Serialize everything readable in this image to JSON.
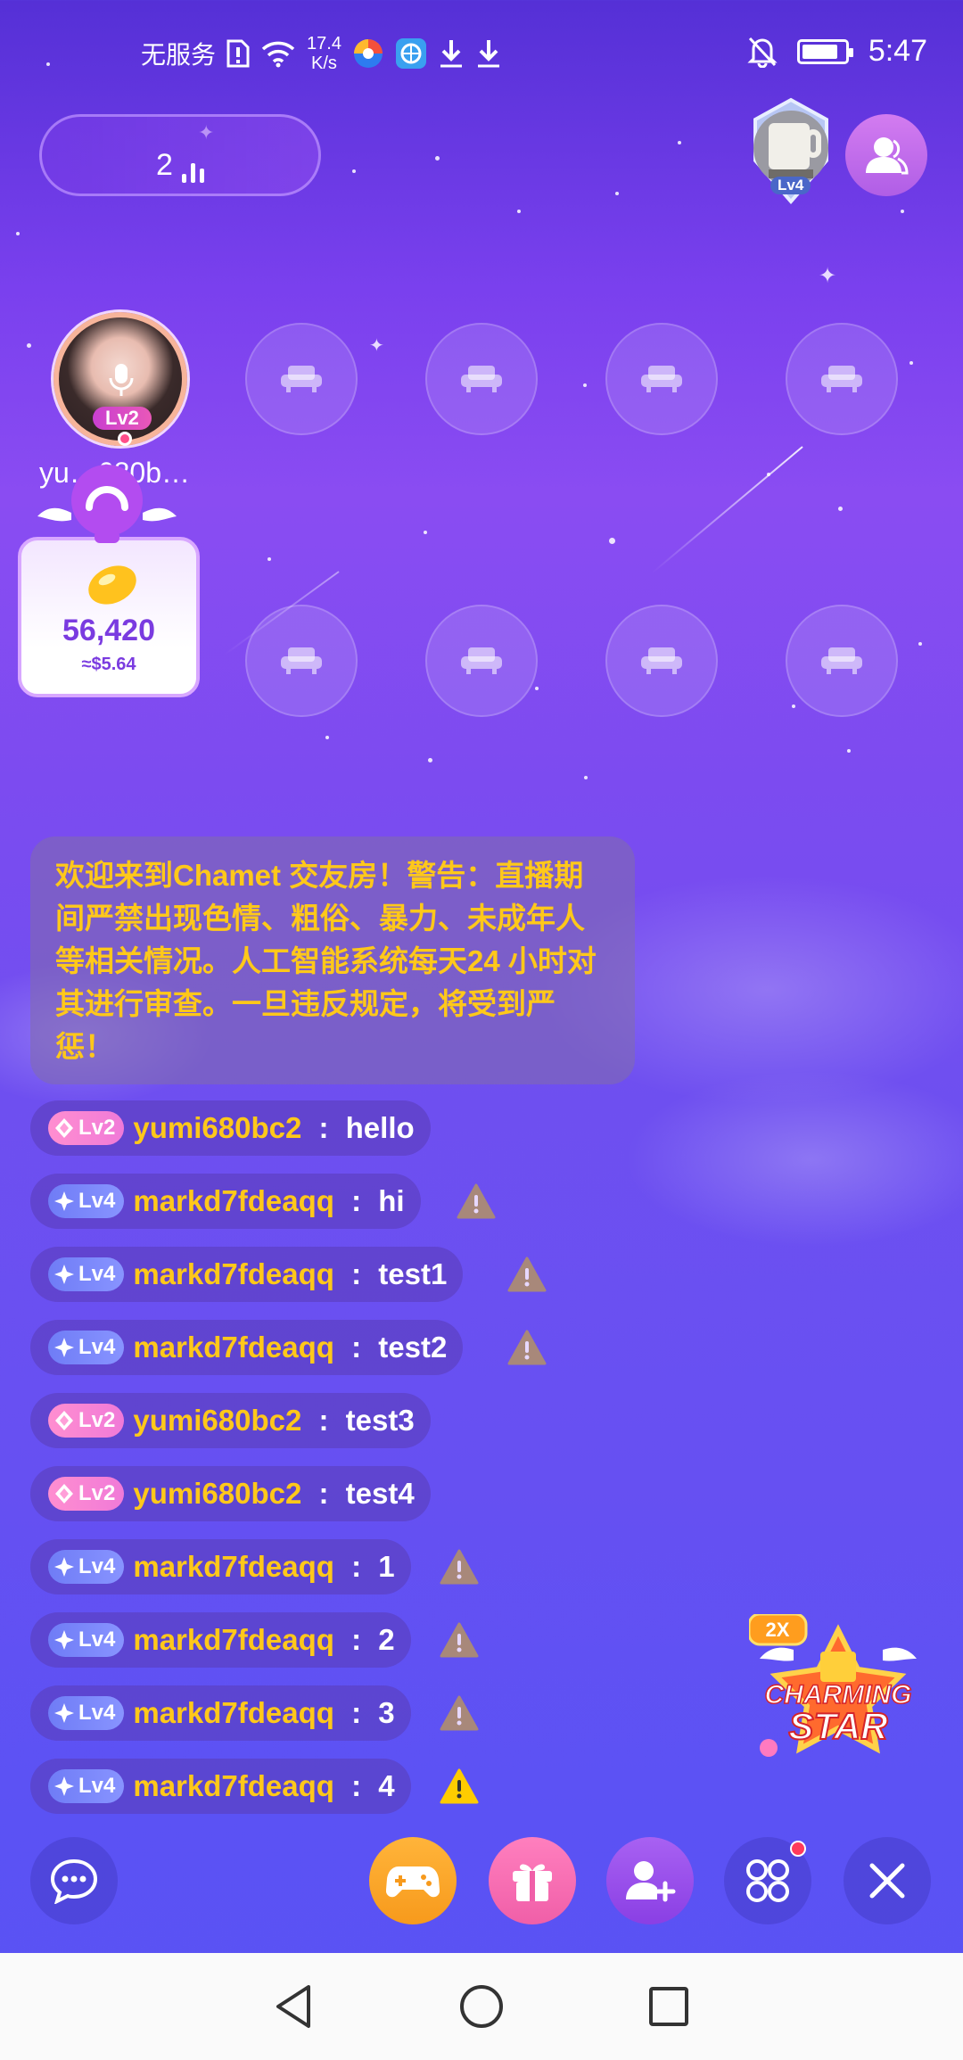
{
  "status_bar": {
    "carrier": "无服务",
    "net_speed_value": "17.4",
    "net_speed_unit": "K/s",
    "time": "5:47",
    "battery_level": 0.85,
    "icons": [
      "sim-alert-icon",
      "wifi-icon",
      "app-browser-icon",
      "app-vpn-icon",
      "download-icon",
      "download-icon",
      "mute-bell-icon",
      "battery-icon"
    ]
  },
  "header": {
    "online_count": "2",
    "host_level": "Lv4"
  },
  "host_seat": {
    "level": "Lv2",
    "name": "yumi680bc2",
    "name_display": "yu…680b…"
  },
  "gift_card": {
    "value": "56,420",
    "usd": "≈$5.64"
  },
  "seat_count_visible": 8,
  "notice": {
    "text": "欢迎来到Chamet 交友房！警告：直播期间严禁出现色情、粗俗、暴力、未成年人等相关情况。人工智能系统每天24 小时对其进行审查。一旦违反规定，将受到严惩！"
  },
  "chat": [
    {
      "level": "Lv2",
      "kind": "lv2",
      "user": "yumi680bc2",
      "message": "hello",
      "warn": false
    },
    {
      "level": "Lv4",
      "kind": "lv4",
      "user": "markd7fdeaqq",
      "message": "hi",
      "warn": true,
      "warn_active": false
    },
    {
      "level": "Lv4",
      "kind": "lv4",
      "user": "markd7fdeaqq",
      "message": "test1",
      "warn": true,
      "warn_active": false
    },
    {
      "level": "Lv4",
      "kind": "lv4",
      "user": "markd7fdeaqq",
      "message": "test2",
      "warn": true,
      "warn_active": false
    },
    {
      "level": "Lv2",
      "kind": "lv2",
      "user": "yumi680bc2",
      "message": "test3",
      "warn": false
    },
    {
      "level": "Lv2",
      "kind": "lv2",
      "user": "yumi680bc2",
      "message": "test4",
      "warn": false
    },
    {
      "level": "Lv4",
      "kind": "lv4",
      "user": "markd7fdeaqq",
      "message": "1",
      "warn": true,
      "warn_active": false
    },
    {
      "level": "Lv4",
      "kind": "lv4",
      "user": "markd7fdeaqq",
      "message": "2",
      "warn": true,
      "warn_active": false
    },
    {
      "level": "Lv4",
      "kind": "lv4",
      "user": "markd7fdeaqq",
      "message": "3",
      "warn": true,
      "warn_active": false
    },
    {
      "level": "Lv4",
      "kind": "lv4",
      "user": "markd7fdeaqq",
      "message": "4",
      "warn": true,
      "warn_active": true
    }
  ],
  "chat_separator": " : ",
  "promo": {
    "multiplier": "2X",
    "line1": "CHARMING",
    "line2": "STAR"
  },
  "colors": {
    "username": "#ffc81a",
    "notice_text": "#ffc81a",
    "game_button": "#f79a1c",
    "gift_button": "#f05fa8",
    "invite_button": "#8a3fe4",
    "warn_inactive": "#a8887a",
    "warn_active": "#ffcc00"
  },
  "toolbar": {
    "icons": [
      "chat-icon",
      "gamepad-icon",
      "gift-icon",
      "invite-icon",
      "apps-icon",
      "close-icon"
    ]
  }
}
